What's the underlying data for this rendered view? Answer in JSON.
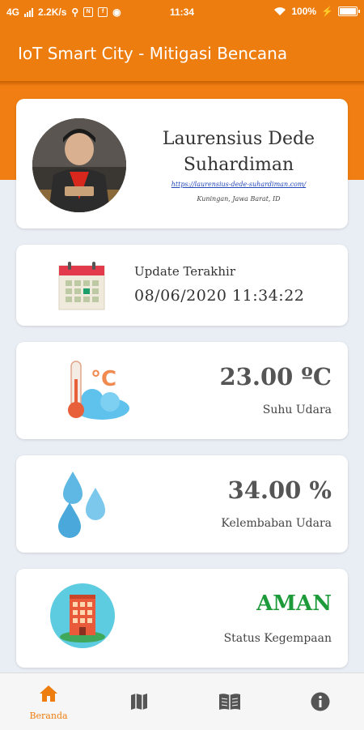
{
  "status_bar": {
    "network": "4G",
    "speed": "2.2K/s",
    "time": "11:34",
    "battery": "100%"
  },
  "app_bar": {
    "title": "IoT Smart City - Mitigasi Bencana"
  },
  "profile": {
    "name": "Laurensius Dede Suhardiman",
    "url": "https://laurensius-dede-suhardiman.com/",
    "location": "Kuningan, Jawa Barat, ID"
  },
  "update": {
    "label": "Update Terakhir",
    "value": "08/06/2020 11:34:22"
  },
  "temperature": {
    "value": "23.00 ºC",
    "label": "Suhu Udara"
  },
  "humidity": {
    "value": "34.00 %",
    "label": "Kelembaban Udara"
  },
  "earthquake": {
    "value": "AMAN",
    "label": "Status Kegempaan",
    "status_color": "#1d9a3a"
  },
  "bottom_nav": {
    "items": [
      {
        "label": "Beranda",
        "icon": "home-icon",
        "active": true
      },
      {
        "icon": "map-icon"
      },
      {
        "icon": "book-icon"
      },
      {
        "icon": "info-icon"
      }
    ]
  },
  "colors": {
    "accent": "#ee7d10",
    "background": "#e9eef4"
  }
}
